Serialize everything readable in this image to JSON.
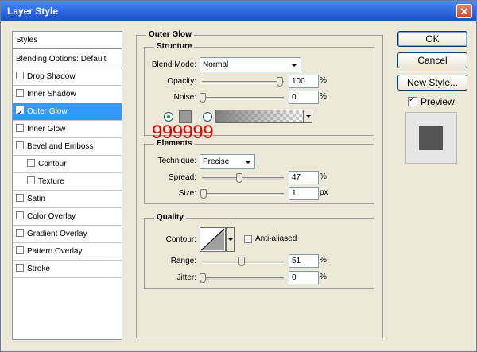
{
  "window": {
    "title": "Layer Style",
    "close_label": "✕"
  },
  "styles_panel": {
    "header": "Styles",
    "blending": "Blending Options: Default",
    "items": [
      {
        "label": "Drop Shadow",
        "checked": false
      },
      {
        "label": "Inner Shadow",
        "checked": false
      },
      {
        "label": "Outer Glow",
        "checked": true
      },
      {
        "label": "Inner Glow",
        "checked": false
      },
      {
        "label": "Bevel and Emboss",
        "checked": false
      },
      {
        "label": "Contour",
        "checked": false
      },
      {
        "label": "Texture",
        "checked": false
      },
      {
        "label": "Satin",
        "checked": false
      },
      {
        "label": "Color Overlay",
        "checked": false
      },
      {
        "label": "Gradient Overlay",
        "checked": false
      },
      {
        "label": "Pattern Overlay",
        "checked": false
      },
      {
        "label": "Stroke",
        "checked": false
      }
    ]
  },
  "outer_glow": {
    "title": "Outer Glow",
    "structure": {
      "title": "Structure",
      "blend_mode_label": "Blend Mode:",
      "blend_mode_value": "Normal",
      "opacity_label": "Opacity:",
      "opacity_value": "100",
      "opacity_unit": "%",
      "noise_label": "Noise:",
      "noise_value": "0",
      "noise_unit": "%",
      "glow_color": "#999999",
      "color_annotation": "999999"
    },
    "elements": {
      "title": "Elements",
      "technique_label": "Technique:",
      "technique_value": "Precise",
      "spread_label": "Spread:",
      "spread_value": "47",
      "spread_unit": "%",
      "size_label": "Size:",
      "size_value": "1",
      "size_unit": "px"
    },
    "quality": {
      "title": "Quality",
      "contour_label": "Contour:",
      "anti_aliased_label": "Anti-aliased",
      "anti_aliased_checked": false,
      "range_label": "Range:",
      "range_value": "51",
      "range_unit": "%",
      "jitter_label": "Jitter:",
      "jitter_value": "0",
      "jitter_unit": "%"
    }
  },
  "buttons": {
    "ok": "OK",
    "cancel": "Cancel",
    "new_style": "New Style..."
  },
  "preview": {
    "label": "Preview",
    "checked": true,
    "swatch_color": "#555555"
  }
}
